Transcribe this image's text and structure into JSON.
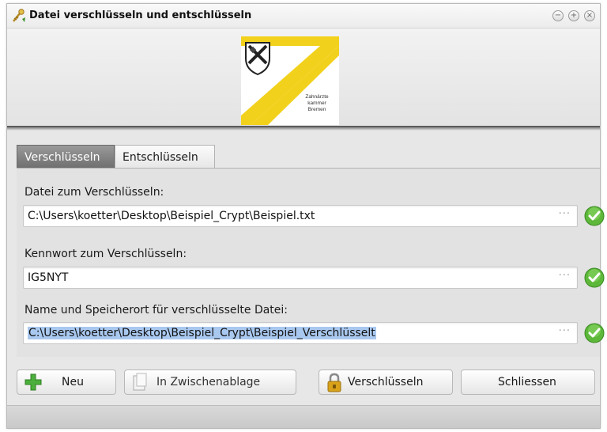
{
  "window": {
    "title": "Datei verschlüsseln und entschlüsseln",
    "controls": [
      "minimize-icon",
      "maximize-icon",
      "close-icon"
    ]
  },
  "logo": {
    "lines": [
      "Zahnärzte",
      "kammer",
      "Bremen"
    ],
    "colors": {
      "stripe": "#f2d11c",
      "shield": "#333333"
    }
  },
  "tabs": [
    {
      "label": "Verschlüsseln",
      "active": true
    },
    {
      "label": "Entschlüsseln",
      "active": false
    }
  ],
  "form": {
    "file": {
      "label": "Datei zum Verschlüsseln:",
      "value": "C:\\Users\\koetter\\Desktop\\Beispiel_Crypt\\Beispiel.txt",
      "browse": "···"
    },
    "password": {
      "label": "Kennwort zum Verschlüsseln:",
      "value": "IG5NYT",
      "browse": "···"
    },
    "output": {
      "label": "Name und Speicherort für verschlüsselte Datei:",
      "value": "C:\\Users\\koetter\\Desktop\\Beispiel_Crypt\\Beispiel_Verschlüsselt",
      "browse": "···"
    }
  },
  "buttons": {
    "new": "Neu",
    "clipboard": "In Zwischenablage",
    "encrypt": "Verschlüsseln",
    "close": "Schliessen"
  },
  "colors": {
    "valid_check": "#5db83a",
    "selection": "#a9c8ef",
    "active_tab": "#7d7d7d",
    "plus_icon": "#4caf3d",
    "lock_icon": "#d9a21a"
  }
}
